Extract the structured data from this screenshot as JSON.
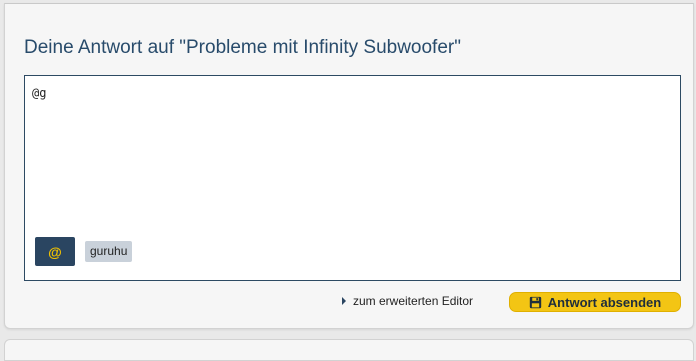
{
  "reply": {
    "title": "Deine Antwort auf \"Probleme mit Infinity Subwoofer\"",
    "editor_text": "@g",
    "mention_button_label": "@",
    "mention_suggestion": "guruhu",
    "advanced_editor_link": "zum erweiterten Editor",
    "submit_label": "Antwort absenden",
    "icons": {
      "caret": "caret-right-icon",
      "submit": "floppy-disk-icon"
    },
    "colors": {
      "title": "#284b6b",
      "editor_border": "#2d4a63",
      "mention_button_bg": "#2a4561",
      "mention_button_fg": "#f2c200",
      "suggestion_bg": "#c9d1da",
      "submit_bg": "#f3c514"
    }
  }
}
